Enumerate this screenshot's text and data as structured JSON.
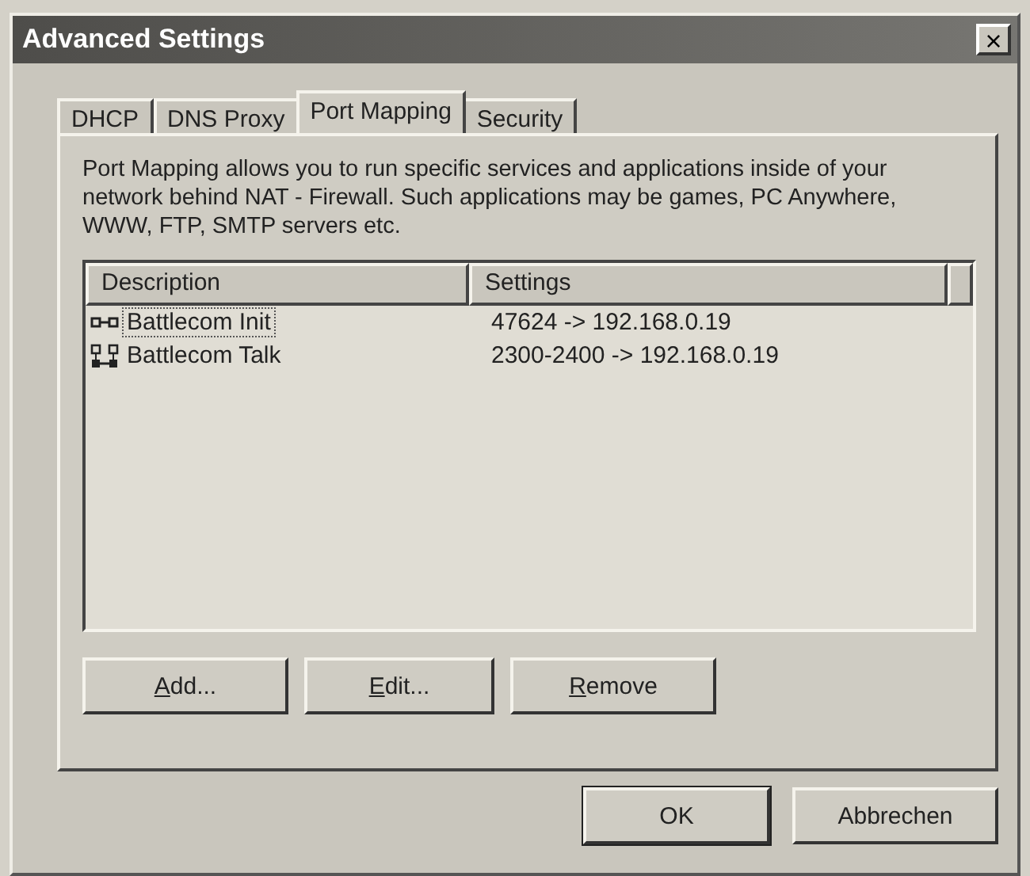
{
  "window": {
    "title": "Advanced Settings",
    "close": "×"
  },
  "tabs": [
    {
      "label": "DHCP",
      "selected": false
    },
    {
      "label": "DNS Proxy",
      "selected": false
    },
    {
      "label": "Port Mapping",
      "selected": true
    },
    {
      "label": "Security",
      "selected": false
    }
  ],
  "description": "Port Mapping allows you to run specific services and applications inside of your network behind NAT - Firewall. Such applications may be games, PC Anywhere, WWW, FTP, SMTP servers etc.",
  "table": {
    "columns": [
      "Description",
      "Settings"
    ],
    "rows": [
      {
        "kind": "single",
        "description": "Battlecom Init",
        "settings": "47624 -> 192.168.0.19",
        "focused": true
      },
      {
        "kind": "multi",
        "description": "Battlecom Talk",
        "settings": "2300-2400 -> 192.168.0.19",
        "focused": false
      }
    ]
  },
  "buttons": [
    {
      "label": "Add...",
      "underline_first": true
    },
    {
      "label": "Edit...",
      "underline_first": true
    },
    {
      "label": "Remove",
      "underline_first": true
    }
  ],
  "footer_buttons": [
    {
      "label": "OK",
      "default": true
    },
    {
      "label": "Abbrechen",
      "default": false
    }
  ]
}
